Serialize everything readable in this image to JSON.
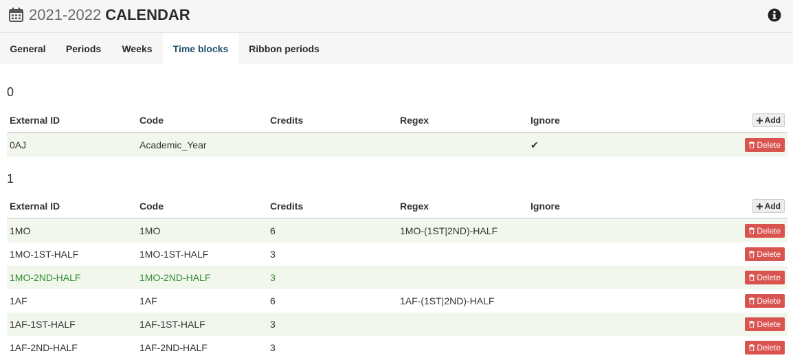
{
  "header": {
    "year": "2021-2022",
    "name": "CALENDAR"
  },
  "tabs": [
    {
      "label": "General"
    },
    {
      "label": "Periods"
    },
    {
      "label": "Weeks"
    },
    {
      "label": "Time blocks",
      "active": true
    },
    {
      "label": "Ribbon periods"
    }
  ],
  "columns": [
    "External ID",
    "Code",
    "Credits",
    "Regex",
    "Ignore"
  ],
  "buttons": {
    "add": "Add",
    "delete": "Delete"
  },
  "sections": [
    {
      "title": "0",
      "rows": [
        {
          "external_id": "0AJ",
          "code": "Academic_Year",
          "credits": "",
          "regex": "",
          "ignore": "✔"
        }
      ]
    },
    {
      "title": "1",
      "rows": [
        {
          "external_id": "1MO",
          "code": "1MO",
          "credits": "6",
          "regex": "1MO-(1ST|2ND)-HALF",
          "ignore": ""
        },
        {
          "external_id": "1MO-1ST-HALF",
          "code": "1MO-1ST-HALF",
          "credits": "3",
          "regex": "",
          "ignore": ""
        },
        {
          "external_id": "1MO-2ND-HALF",
          "code": "1MO-2ND-HALF",
          "credits": "3",
          "regex": "",
          "ignore": ""
        },
        {
          "external_id": "1AF",
          "code": "1AF",
          "credits": "6",
          "regex": "1AF-(1ST|2ND)-HALF",
          "ignore": ""
        },
        {
          "external_id": "1AF-1ST-HALF",
          "code": "1AF-1ST-HALF",
          "credits": "3",
          "regex": "",
          "ignore": ""
        },
        {
          "external_id": "1AF-2ND-HALF",
          "code": "1AF-2ND-HALF",
          "credits": "3",
          "regex": "",
          "ignore": ""
        }
      ]
    }
  ],
  "colors": {
    "delete": "#d9534f",
    "active_tab_text": "#1c4f6b",
    "highlight_row_text": "#2e8b2e",
    "alt_row_bg": "#f2f7ee"
  }
}
